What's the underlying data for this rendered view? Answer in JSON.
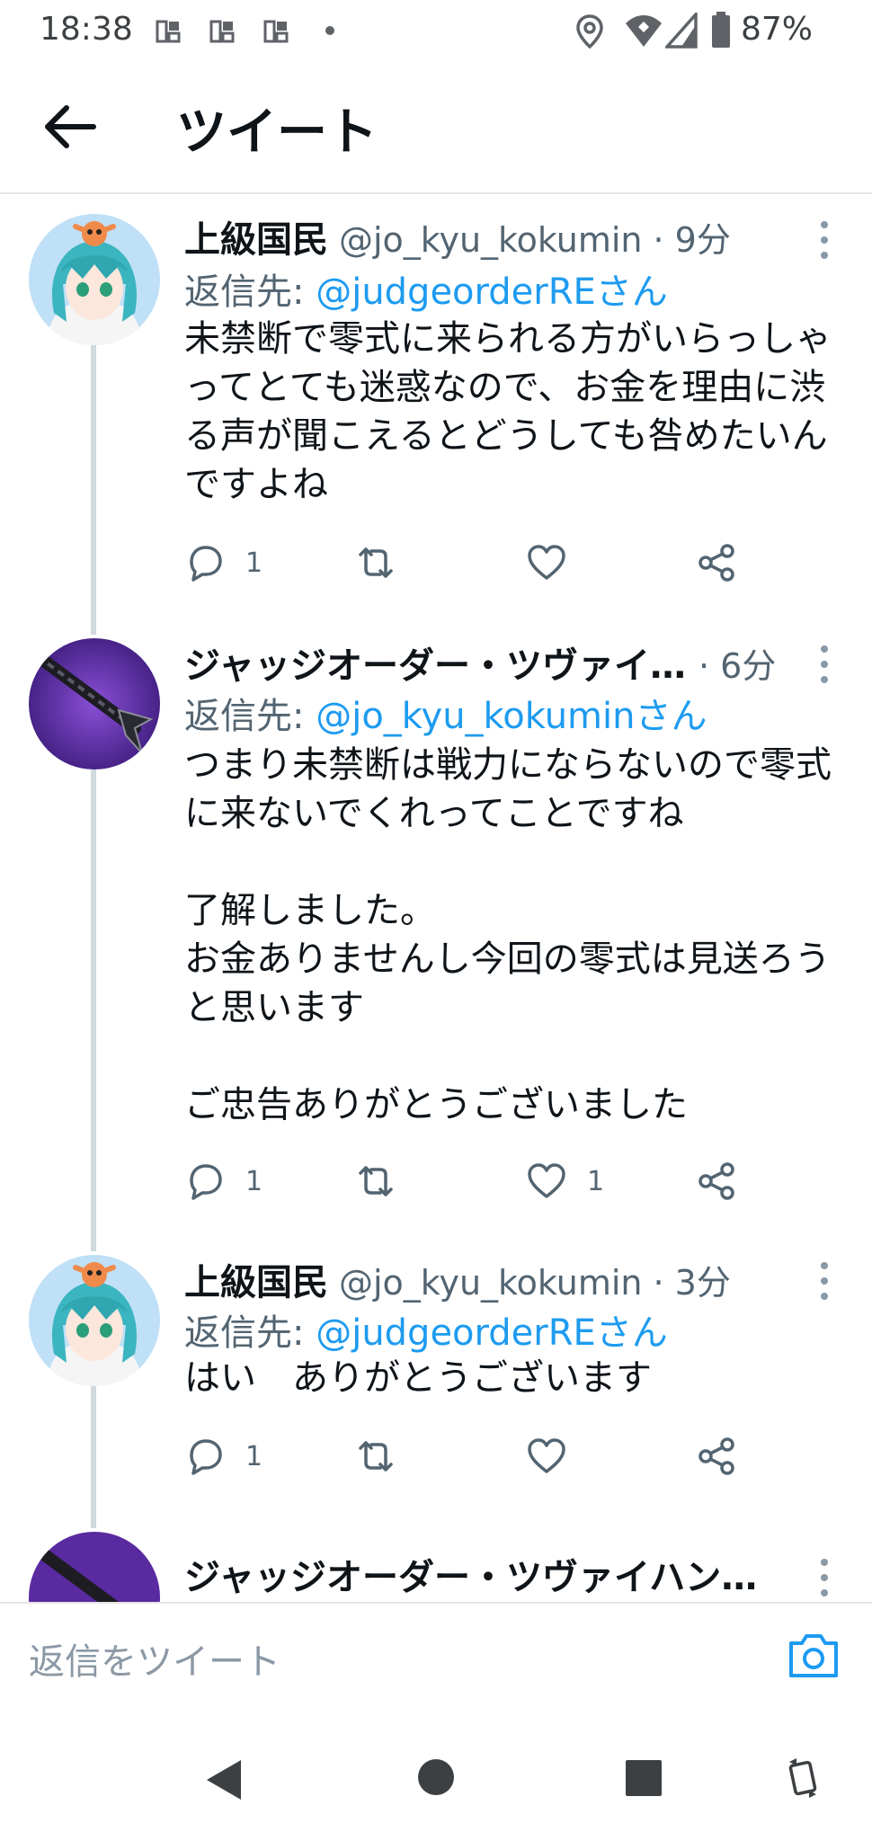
{
  "status_bar": {
    "time": "18:38",
    "notif_icons": [
      "app-notification-icon",
      "app-notification-icon",
      "app-notification-icon"
    ],
    "battery": "87%"
  },
  "header": {
    "title": "ツイート"
  },
  "tweets": [
    {
      "name": "上級国民",
      "handle": "@jo_kyu_kokumin",
      "time": "· 9分",
      "reply_prefix": "返信先: ",
      "reply_to": "@judgeorderREさん",
      "text": "未禁断で零式に来られる方がいらっしゃ\nってとても迷惑なので、お金を理由に渋\nる声が聞こえるとどうしても咎めたいん\nですよね",
      "replies": "1",
      "retweets": "",
      "likes": ""
    },
    {
      "name": "ジャッジオーダー・ツヴァイ…",
      "handle": "",
      "time": "· 6分",
      "reply_prefix": "返信先: ",
      "reply_to": "@jo_kyu_kokuminさん",
      "text": "つまり未禁断は戦力にならないので零式\nに来ないでくれってことですね\n\n了解しました。\nお金ありませんし今回の零式は見送ろう\nと思います\n\nご忠告ありがとうございました",
      "replies": "1",
      "retweets": "",
      "likes": "1"
    },
    {
      "name": "上級国民",
      "handle": "@jo_kyu_kokumin",
      "time": "· 3分",
      "reply_prefix": "返信先: ",
      "reply_to": "@judgeorderREさん",
      "text": "はい　ありがとうございます",
      "replies": "1",
      "retweets": "",
      "likes": ""
    },
    {
      "name": "ジャッジオーダー・ツヴァイハン…"
    }
  ],
  "compose": {
    "placeholder": "返信をツイート"
  },
  "colors": {
    "link": "#1d9bf0",
    "muted": "#536471",
    "text": "#0f1419"
  }
}
